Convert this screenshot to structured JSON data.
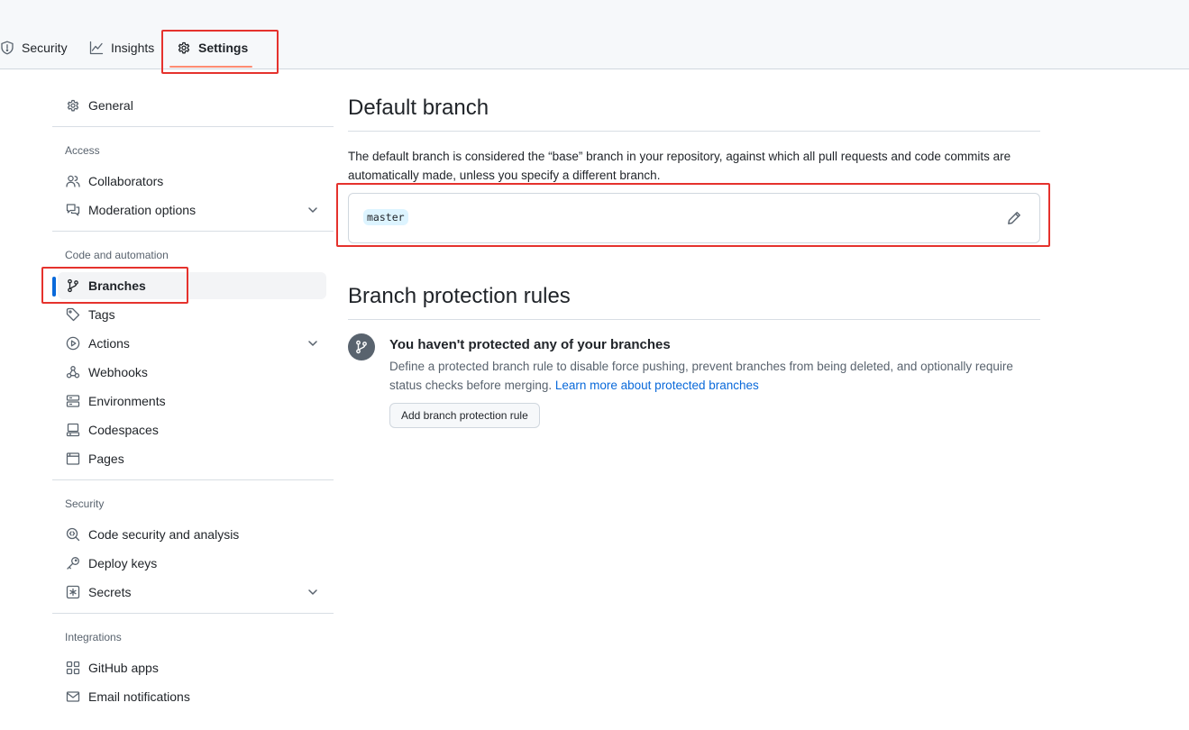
{
  "tabs": {
    "security": "Security",
    "insights": "Insights",
    "settings": "Settings"
  },
  "sidebar": {
    "general": "General",
    "groups": {
      "access": "Access",
      "code": "Code and automation",
      "security": "Security",
      "integrations": "Integrations"
    },
    "items": {
      "collaborators": "Collaborators",
      "moderation": "Moderation options",
      "branches": "Branches",
      "tags": "Tags",
      "actions": "Actions",
      "webhooks": "Webhooks",
      "environments": "Environments",
      "codespaces": "Codespaces",
      "pages": "Pages",
      "code_security": "Code security and analysis",
      "deploy_keys": "Deploy keys",
      "secrets": "Secrets",
      "github_apps": "GitHub apps",
      "email_notifications": "Email notifications"
    },
    "active_item": "Branches"
  },
  "main": {
    "default_branch": {
      "title": "Default branch",
      "description": "The default branch is considered the “base” branch in your repository, against which all pull requests and code commits are automatically made, unless you specify a different branch.",
      "branch_name": "master"
    },
    "protection": {
      "title": "Branch protection rules",
      "empty_title": "You haven't protected any of your branches",
      "empty_description": "Define a protected branch rule to disable force pushing, prevent branches from being deleted, and optionally require status checks before merging.",
      "learn_more": "Learn more about protected branches",
      "add_button": "Add branch protection rule"
    }
  },
  "colors": {
    "accent": "#0969da",
    "tab_underline": "#fd8c73",
    "highlight": "#e5322d",
    "branch_chip": "#ddf4ff"
  },
  "icons": [
    "shield-icon",
    "graph-icon",
    "gear-icon",
    "people-icon",
    "comment-discussion-icon",
    "git-branch-icon",
    "tag-icon",
    "play-icon",
    "webhook-icon",
    "server-icon",
    "codespaces-icon",
    "browser-icon",
    "codescan-icon",
    "key-icon",
    "key-asterisk-icon",
    "apps-icon",
    "mail-icon",
    "pencil-icon",
    "chevron-down-icon"
  ]
}
